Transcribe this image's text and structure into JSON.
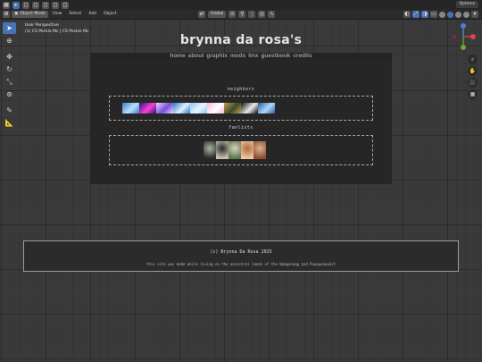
{
  "header": {
    "mode_label": "Object Mode",
    "menus": [
      "View",
      "Select",
      "Add",
      "Object"
    ],
    "transform_orientation": "Global",
    "options_label": "Options"
  },
  "overlay": {
    "perspective": "User Perspective",
    "collection": "(1) CS Peckle Mc | CS Peckle Mc"
  },
  "site": {
    "title": "brynna da rosa's",
    "nav": [
      "home",
      "about",
      "graphix",
      "mods",
      "linx",
      "guestbook",
      "credits"
    ],
    "neighbors_label": "neighbors",
    "fanlists_label": "fanlists",
    "footer_copyright": "(c) Brynna Da Rosa 2025",
    "footer_note": "this site was made while living on the ancestral lands of the Wampanoag and Pauquunaukit"
  },
  "colors": {
    "accent": "#4772b3",
    "panel": "#262626",
    "viewport": "#3a3a3a"
  },
  "neighbor_buttons": [
    {
      "name": "neighbor-button-1",
      "c1": "#3a7fc4",
      "c2": "#b7e0ff"
    },
    {
      "name": "neighbor-button-2",
      "c1": "#1a1a7a",
      "c2": "#ff3fd8"
    },
    {
      "name": "neighbor-button-3",
      "c1": "#e6d6ff",
      "c2": "#7a4fd8"
    },
    {
      "name": "neighbor-button-4",
      "c1": "#2a78c8",
      "c2": "#dff1ff"
    },
    {
      "name": "neighbor-button-5",
      "c1": "#8bc6f0",
      "c2": "#e8f7ff"
    },
    {
      "name": "neighbor-button-6",
      "c1": "#f2b8d8",
      "c2": "#ffffff"
    },
    {
      "name": "neighbor-button-7",
      "c1": "#c8a050",
      "c2": "#3a4a2a"
    },
    {
      "name": "neighbor-button-8",
      "c1": "#111111",
      "c2": "#e8e8e8"
    },
    {
      "name": "neighbor-button-9",
      "c1": "#1e5fa8",
      "c2": "#b0d8f8"
    }
  ],
  "fanlist_icons": [
    {
      "name": "fanlist-icon-1",
      "c1": "#2a2a2a",
      "c2": "#a8b8a0"
    },
    {
      "name": "fanlist-icon-2",
      "c1": "#c8c0b0",
      "c2": "#2a2a2a"
    },
    {
      "name": "fanlist-icon-3",
      "c1": "#5a7a4a",
      "c2": "#d8d0c0"
    },
    {
      "name": "fanlist-icon-4",
      "c1": "#f0c8a8",
      "c2": "#b06a3a"
    },
    {
      "name": "fanlist-icon-5",
      "c1": "#8a5030",
      "c2": "#e0b090"
    }
  ]
}
